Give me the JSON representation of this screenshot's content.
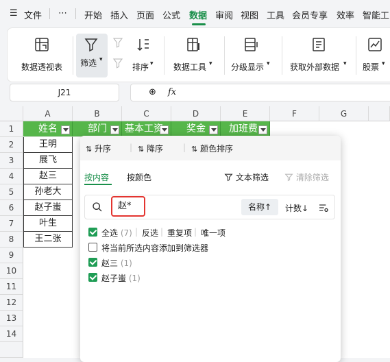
{
  "menubar": {
    "hamburger": "☰",
    "file": "文件",
    "more": "⋯",
    "tabs": [
      "开始",
      "插入",
      "页面",
      "公式",
      "数据",
      "审阅",
      "视图",
      "工具",
      "会员专享",
      "效率",
      "智能工"
    ],
    "active_tab": "数据"
  },
  "ribbon": {
    "pivot": "数据透视表",
    "filter": "筛选",
    "sort": "排序",
    "data_tools": "数据工具",
    "outline": "分级显示",
    "external": "获取外部数据",
    "stocks": "股票"
  },
  "formulabar": {
    "cell_ref": "J21",
    "fx": "fx",
    "zoom_icon": "⊕",
    "formula": ""
  },
  "sheet": {
    "columns": [
      "A",
      "B",
      "C",
      "D",
      "E",
      "F",
      "G"
    ],
    "rows": [
      "1",
      "2",
      "3",
      "4",
      "5",
      "6",
      "7",
      "8",
      "9",
      "10",
      "11",
      "12",
      "13",
      "14"
    ],
    "headers": [
      "姓名",
      "部门",
      "基本工资",
      "奖金",
      "加班费"
    ],
    "names": [
      "王明",
      "展飞",
      "赵三",
      "孙老大",
      "赵子蚩",
      "叶生",
      "王二张"
    ]
  },
  "filter_popup": {
    "sort_asc": "升序",
    "sort_desc": "降序",
    "sort_color": "颜色排序",
    "tab_content": "按内容",
    "tab_color": "按颜色",
    "text_filter": "文本筛选",
    "clear_filter": "清除筛选",
    "search_value": "赵*",
    "sort_name": "名称↑",
    "sort_count": "计数↓",
    "select_all": "全选",
    "select_all_count": "(7)",
    "invert": "反选",
    "duplicates": "重复项",
    "unique": "唯一项",
    "add_to_filter": "将当前所选内容添加到筛选器",
    "items": [
      {
        "label": "赵三",
        "count": "(1)"
      },
      {
        "label": "赵子蚩",
        "count": "(1)"
      }
    ]
  },
  "colors": {
    "accent": "#1a8f4a",
    "header_green": "#56b64a",
    "highlight_red": "#e3342f"
  }
}
